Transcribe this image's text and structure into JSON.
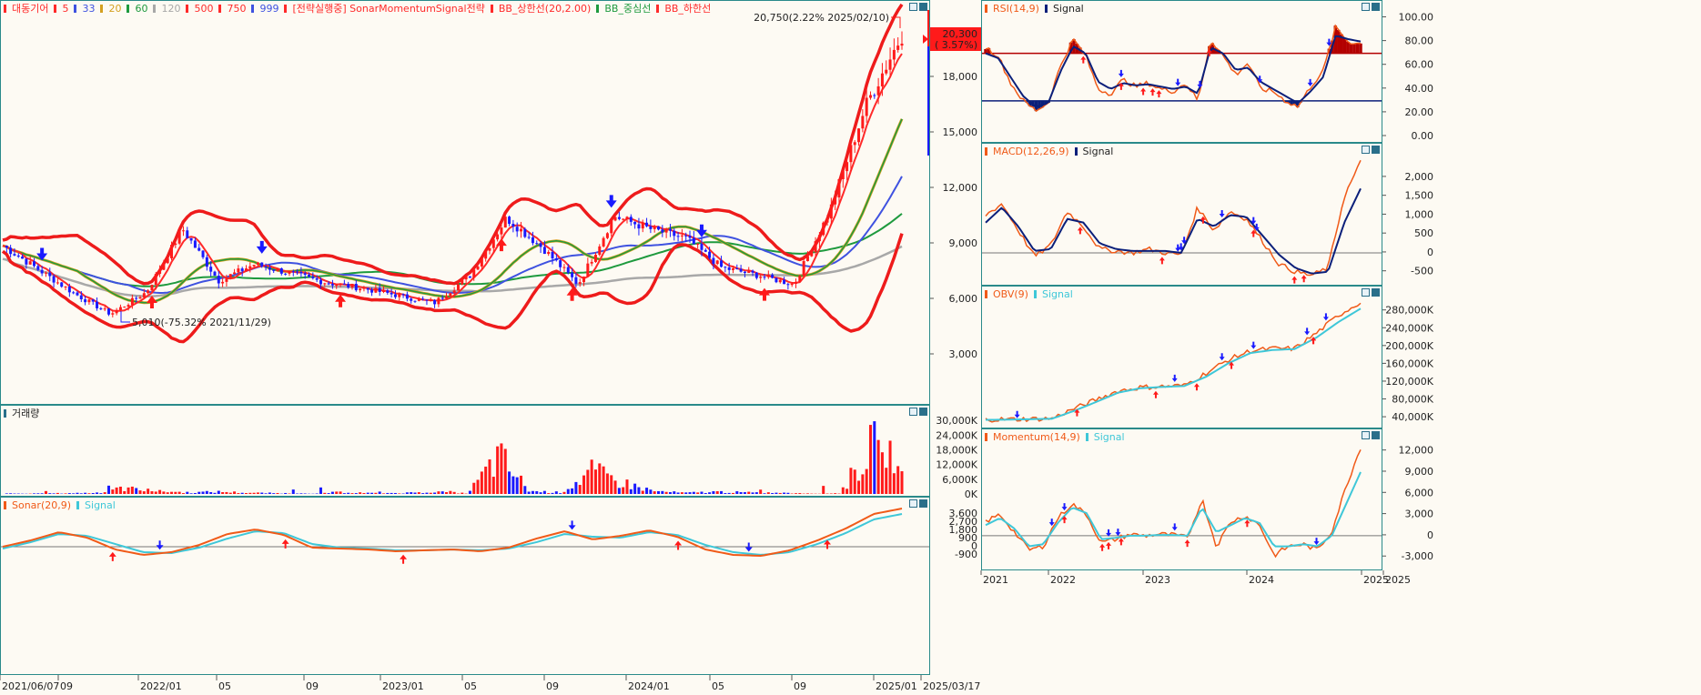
{
  "colors": {
    "up": "#ff1a1a",
    "down": "#1a1aff",
    "bb": "#ee1b1b",
    "ma5": "#ff2a2a",
    "ma33": "#3f52e0",
    "ma20": "#d4a020",
    "ma60": "#1e9a3e",
    "ma120": "#a8a8a8",
    "frame": "#2a8a8a",
    "orange": "#f05a18",
    "navy": "#0b1f7a",
    "sky": "#3ec7d8",
    "rsiUp": "#b30000",
    "rsiDown": "#0b1f7a"
  },
  "main": {
    "legend": [
      {
        "text": "대동기어",
        "color": "#ff2a2a"
      },
      {
        "text": "5",
        "color": "#ff2a2a"
      },
      {
        "text": "33",
        "color": "#3f52e0"
      },
      {
        "text": "20",
        "color": "#d4a020"
      },
      {
        "text": "60",
        "color": "#1e9a3e"
      },
      {
        "text": "120",
        "color": "#a8a8a8"
      },
      {
        "text": "500",
        "color": "#ff2a2a"
      },
      {
        "text": "750",
        "color": "#ff2a2a"
      },
      {
        "text": "999",
        "color": "#3f52e0"
      },
      {
        "text": "[전략실행중] SonarMomentumSignal전략",
        "color": "#ff2a2a"
      },
      {
        "text": "BB_상한선(20,2.00)",
        "color": "#ff2a2a"
      },
      {
        "text": "BB_중심선",
        "color": "#1e9a3e"
      },
      {
        "text": "BB_하한선",
        "color": "#ff2a2a"
      }
    ],
    "high_label": "20,750(2.22% 2025/02/10)",
    "low_label": "5,010(-75.32% 2021/11/29)",
    "price_box_1": "20,300",
    "price_box_2": "( 3.57%)",
    "y_ticks": [
      "18,000",
      "15,000",
      "12,000",
      "9,000",
      "6,000",
      "3,000"
    ]
  },
  "volume": {
    "title": "거래량",
    "y_ticks": [
      "30,000K",
      "24,000K",
      "18,000K",
      "12,000K",
      "6,000K",
      "0K"
    ]
  },
  "sonar": {
    "title_a": "Sonar(20,9)",
    "title_b": "Signal",
    "y_ticks": [
      "3,600",
      "2,700",
      "1,800",
      "900",
      "0",
      "-900"
    ]
  },
  "dates_left": [
    "2021/06/07",
    "09",
    "2022/01",
    "05",
    "09",
    "2023/01",
    "05",
    "09",
    "2024/01",
    "05",
    "09",
    "2025/01",
    "2025/03/17"
  ],
  "rsi": {
    "title_a": "RSI(14,9)",
    "title_b": "Signal",
    "y_ticks": [
      "100.00",
      "80.00",
      "60.00",
      "40.00",
      "20.00",
      "0.00"
    ]
  },
  "macd": {
    "title_a": "MACD(12,26,9)",
    "title_b": "Signal",
    "y_ticks": [
      "2,000",
      "1,500",
      "1,000",
      "500",
      "0",
      "-500"
    ]
  },
  "obv": {
    "title_a": "OBV(9)",
    "title_b": "Signal",
    "y_ticks": [
      "280,000K",
      "240,000K",
      "200,000K",
      "160,000K",
      "120,000K",
      "80,000K",
      "40,000K"
    ]
  },
  "momentum": {
    "title_a": "Momentum(14,9)",
    "title_b": "Signal",
    "y_ticks": [
      "12,000",
      "9,000",
      "6,000",
      "3,000",
      "0",
      "-3,000"
    ]
  },
  "dates_right": [
    "2021",
    "2022",
    "2023",
    "2024",
    "2025",
    "2025"
  ],
  "chart_data": [
    {
      "type": "candlestick",
      "title": "대동기어",
      "x": [
        "2021/06",
        "2021/09",
        "2022/01",
        "2022/05",
        "2022/09",
        "2023/01",
        "2023/05",
        "2023/09",
        "2024/01",
        "2024/05",
        "2024/09",
        "2025/01",
        "2025/03"
      ],
      "close_path": [
        8900,
        7600,
        6300,
        5200,
        6400,
        9800,
        7000,
        7900,
        7400,
        6900,
        6600,
        6200,
        5800,
        7300,
        10400,
        8800,
        6800,
        10500,
        9800,
        9300,
        7700,
        7300,
        6800,
        10800,
        16500,
        20300
      ],
      "ylim": [
        3000,
        21000
      ],
      "annotations": [
        "20,750(2.22% 2025/02/10)",
        "5,010(-75.32% 2021/11/29)"
      ]
    },
    {
      "type": "bar",
      "title": "거래량",
      "unit": "K",
      "ylim": [
        0,
        36000
      ]
    },
    {
      "type": "line",
      "title": "Sonar(20,9)",
      "series": [
        {
          "name": "Sonar(20,9)",
          "values": [
            0,
            700,
            1600,
            1000,
            -300,
            -900,
            -600,
            200,
            1400,
            1900,
            1300,
            -100,
            -200,
            -300,
            -500,
            -400,
            -300,
            -500,
            -100,
            900,
            1700,
            800,
            1200,
            1800,
            1100,
            -300,
            -900,
            -1000,
            -400,
            700,
            2000,
            3600,
            4200
          ]
        },
        {
          "name": "Signal",
          "values": [
            -200,
            500,
            1400,
            1200,
            300,
            -600,
            -700,
            -100,
            900,
            1700,
            1500,
            300,
            -100,
            -200,
            -400,
            -400,
            -300,
            -400,
            -200,
            500,
            1400,
            1100,
            1000,
            1600,
            1300,
            200,
            -600,
            -900,
            -600,
            300,
            1500,
            3000,
            3600
          ]
        }
      ],
      "ylim": [
        -900,
        4000
      ]
    },
    {
      "type": "line",
      "title": "RSI(14,9)",
      "series": [
        {
          "name": "RSI(14,9)",
          "values": [
            75,
            68,
            45,
            30,
            22,
            28,
            60,
            82,
            68,
            40,
            36,
            48,
            42,
            45,
            40,
            38,
            45,
            30,
            82,
            68,
            52,
            62,
            40,
            38,
            30,
            25,
            42,
            55,
            92,
            80,
            78
          ]
        },
        {
          "name": "Signal",
          "values": [
            70,
            66,
            50,
            34,
            25,
            28,
            55,
            76,
            70,
            46,
            40,
            45,
            43,
            44,
            42,
            40,
            42,
            36,
            75,
            70,
            56,
            58,
            46,
            40,
            34,
            28,
            38,
            50,
            85,
            82,
            80
          ]
        }
      ],
      "ylim": [
        0,
        100
      ]
    },
    {
      "type": "line",
      "title": "MACD(12,26,9)",
      "series": [
        {
          "name": "MACD(12,26,9)",
          "values": [
            1000,
            1300,
            600,
            -100,
            200,
            1100,
            700,
            100,
            50,
            0,
            100,
            0,
            -50,
            1200,
            600,
            1100,
            900,
            300,
            -300,
            -500,
            -600,
            -400,
            1500,
            2400
          ]
        },
        {
          "name": "Signal",
          "values": [
            800,
            1200,
            700,
            50,
            100,
            900,
            800,
            250,
            100,
            50,
            50,
            50,
            0,
            900,
            700,
            1000,
            950,
            450,
            -50,
            -400,
            -550,
            -500,
            800,
            1700
          ]
        }
      ],
      "ylim": [
        -700,
        2600
      ]
    },
    {
      "type": "line",
      "title": "OBV(9)",
      "series": [
        {
          "name": "OBV(9)",
          "values": [
            36000,
            36000,
            37000,
            38000,
            60000,
            80000,
            100000,
            108000,
            110000,
            112000,
            140000,
            170000,
            190000,
            195000,
            195000,
            230000,
            270000,
            300000
          ]
        },
        {
          "name": "Signal",
          "values": [
            35000,
            35500,
            36500,
            37500,
            55000,
            75000,
            96000,
            106000,
            109000,
            111000,
            132000,
            162000,
            185000,
            192000,
            194000,
            220000,
            255000,
            285000
          ]
        }
      ],
      "ylim": [
        30000,
        310000
      ]
    },
    {
      "type": "line",
      "title": "Momentum(14,9)",
      "series": [
        {
          "name": "Momentum(14,9)",
          "values": [
            2000,
            3000,
            500,
            -2000,
            -1500,
            2500,
            4500,
            3000,
            -1000,
            -500,
            200,
            0,
            200,
            100,
            -300,
            5200,
            -1500,
            2000,
            2800,
            1500,
            -2800,
            -1500,
            -1200,
            -2000,
            600,
            7000,
            12500
          ]
        },
        {
          "name": "Signal",
          "values": [
            1500,
            2500,
            1000,
            -1500,
            -1200,
            1800,
            4000,
            3200,
            -500,
            -300,
            0,
            0,
            100,
            100,
            0,
            4000,
            500,
            1500,
            2500,
            1800,
            -1500,
            -1500,
            -1200,
            -1500,
            0,
            4500,
            9000
          ]
        }
      ],
      "ylim": [
        -4000,
        13500
      ]
    }
  ]
}
